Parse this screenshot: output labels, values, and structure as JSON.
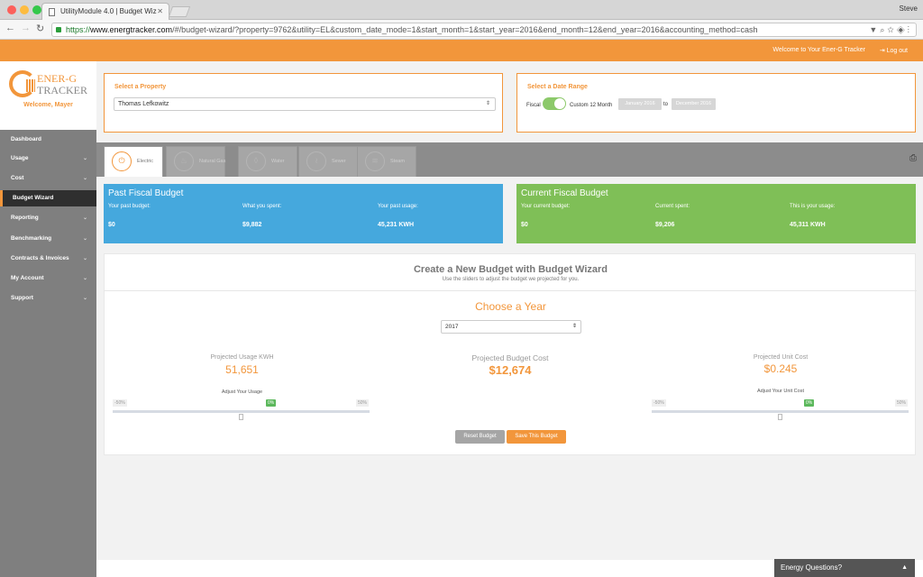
{
  "browser": {
    "tab_title": "UtilityModule 4.0 | Budget Wiz",
    "user": "Steve",
    "url_scheme": "https://",
    "url_host": "www.energtracker.com",
    "url_path": "/#/budget-wizard/?property=9762&utility=EL&custom_date_mode=1&start_month=1&start_year=2016&end_month=12&end_year=2016&accounting_method=cash"
  },
  "header": {
    "welcome": "Welcome to Your Ener-G Tracker",
    "logout": "Log out"
  },
  "sidebar": {
    "logo_line1": "ENER-G",
    "logo_line2": "TRACKER",
    "welcome_user": "Welcome, Mayer",
    "items": [
      {
        "label": "Dashboard",
        "chevron": false
      },
      {
        "label": "Usage",
        "chevron": true
      },
      {
        "label": "Cost",
        "chevron": true
      },
      {
        "label": "Budget Wizard",
        "chevron": false,
        "active": true
      },
      {
        "label": "Reporting",
        "chevron": true
      },
      {
        "label": "Benchmarking",
        "chevron": true
      },
      {
        "label": "Contracts & Invoices",
        "chevron": true
      },
      {
        "label": "My Account",
        "chevron": true
      },
      {
        "label": "Support",
        "chevron": true
      }
    ]
  },
  "property": {
    "title": "Select a Property",
    "value": "Thomas Lefkowitz"
  },
  "date_range": {
    "title": "Select a Date Range",
    "fiscal_label": "Fiscal",
    "toggle_on": true,
    "custom_label": "Custom 12 Month",
    "start": "January 2016",
    "to": "to",
    "end": "December 2016"
  },
  "utility_tabs": [
    {
      "label": "Electric",
      "icon": "plug-icon",
      "active": true
    },
    {
      "label": "Natural Gas",
      "icon": "flame-icon",
      "active": false
    },
    {
      "label": "Water",
      "icon": "water-drop-icon",
      "active": false
    },
    {
      "label": "Sewer",
      "icon": "sewer-icon",
      "active": false
    },
    {
      "label": "Steam",
      "icon": "steam-icon",
      "active": false
    }
  ],
  "past_budget": {
    "title": "Past Fiscal Budget",
    "col1_label": "Your past budget:",
    "col1_value": "$0",
    "col2_label": "What you spent:",
    "col2_value": "$9,882",
    "col3_label": "Your past usage:",
    "col3_value": "45,231 KWH",
    "color": "#45a8dd"
  },
  "current_budget": {
    "title": "Current Fiscal Budget",
    "col1_label": "Your current budget:",
    "col1_value": "$0",
    "col2_label": "Current spent:",
    "col2_value": "$9,206",
    "col3_label": "This is your usage:",
    "col3_value": "45,311 KWH",
    "color": "#7fbf57"
  },
  "wizard": {
    "title": "Create a New Budget with Budget Wizard",
    "subtitle": "Use the sliders to adjust the budget we projected for you.",
    "choose_year": "Choose a Year",
    "year": "2017",
    "usage": {
      "label": "Projected Usage KWH",
      "value": "51,651",
      "adjust_label": "Adjust Your Usage",
      "min": "-50%",
      "current": "0%",
      "max": "50%",
      "level": 0.5
    },
    "cost": {
      "label": "Projected Budget Cost",
      "value": "$12,674"
    },
    "unit_cost": {
      "label": "Projected Unit Cost",
      "value": "$0.245",
      "adjust_label": "Adjust Your Unit Cost",
      "min": "-50%",
      "current": "0%",
      "max": "50%",
      "level": 0.5
    },
    "reset_label": "Reset Budget",
    "save_label": "Save This Budget"
  },
  "chat": {
    "label": "Energy Questions?"
  },
  "colors": {
    "accent": "#f2963b",
    "sidebar": "#7f7f7f",
    "success": "#5cb85c"
  }
}
